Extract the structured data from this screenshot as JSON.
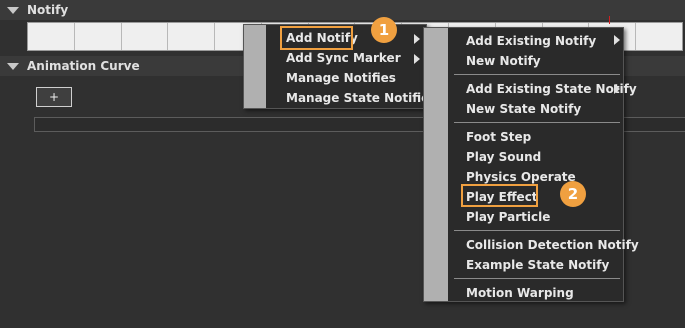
{
  "sections": {
    "notify_title": "Notify",
    "curve_title": "Animation Curve",
    "add_curve_label": "+"
  },
  "menu1": {
    "items": [
      "Add Notify",
      "Add Sync Marker",
      "Manage Notifies",
      "Manage State Notifies"
    ]
  },
  "menu2": {
    "group1": [
      "Add Existing Notify",
      "New Notify"
    ],
    "group2": [
      "Add Existing State Notify",
      "New State Notify"
    ],
    "group3": [
      "Foot Step",
      "Play Sound",
      "Physics Operate",
      "Play Effect",
      "Play Particle"
    ],
    "group4": [
      "Collision Detection Notify",
      "Example State Notify"
    ],
    "group5": [
      "Motion Warping"
    ]
  },
  "badges": [
    "1",
    "2"
  ],
  "colors": {
    "highlight": "#f0a040",
    "playhead": "#d02020"
  }
}
